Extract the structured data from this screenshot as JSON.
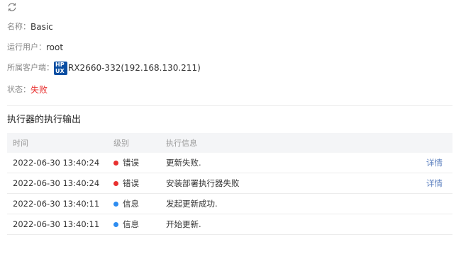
{
  "refresh_icon": "refresh-icon",
  "info": {
    "name_label": "名称：",
    "name_value": "Basic",
    "user_label": "运行用户：",
    "user_value": "root",
    "client_label": "所属客户端：",
    "client_os_icon": "hp-ux-logo",
    "client_value": "RX2660-332(192.168.130.211)",
    "status_label": "状态：",
    "status_value": "失败",
    "status_color": "#e8302f"
  },
  "section": {
    "title": "执行器的执行输出"
  },
  "table": {
    "headers": {
      "time": "时间",
      "level": "级别",
      "message": "执行信息"
    },
    "rows": [
      {
        "time": "2022-06-30 13:40:24",
        "level": "错误",
        "level_color": "#e8302f",
        "message": "更新失败.",
        "action": "详情"
      },
      {
        "time": "2022-06-30 13:40:24",
        "level": "错误",
        "level_color": "#e8302f",
        "message": "安装部署执行器失败",
        "action": "详情"
      },
      {
        "time": "2022-06-30 13:40:11",
        "level": "信息",
        "level_color": "#2d8cf0",
        "message": "发起更新成功.",
        "action": ""
      },
      {
        "time": "2022-06-30 13:40:11",
        "level": "信息",
        "level_color": "#2d8cf0",
        "message": "开始更新.",
        "action": ""
      }
    ]
  }
}
